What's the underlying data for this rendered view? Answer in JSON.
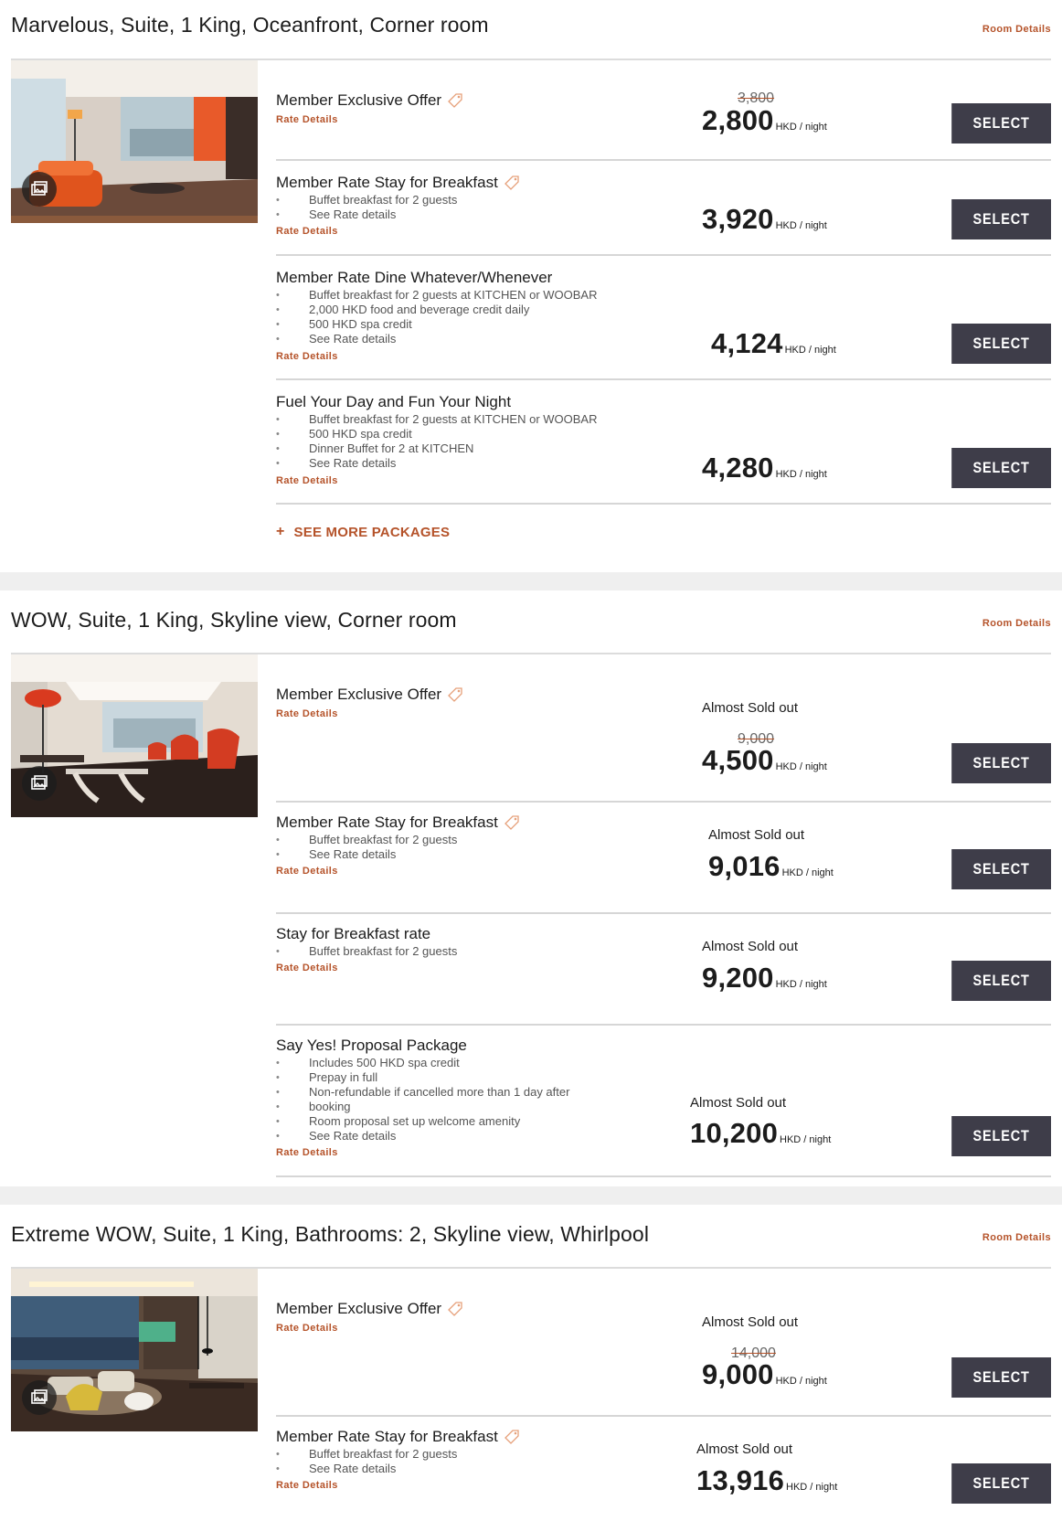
{
  "rooms": [
    {
      "title": "Marvelous, Suite, 1 King, Oceanfront, Corner room",
      "details_link": "Room Details",
      "rates": [
        {
          "name": "Member Exclusive Offer",
          "tag": true,
          "bullets": [],
          "details": "Rate Details",
          "sold_out": "",
          "old_price": "3,800",
          "price": "2,800",
          "unit": "HKD / night",
          "button": "SELECT"
        },
        {
          "name": "Member Rate Stay for Breakfast",
          "tag": true,
          "bullets": [
            "Buffet breakfast for 2 guests",
            "See Rate details"
          ],
          "details": "Rate Details",
          "sold_out": "",
          "old_price": "",
          "price": "3,920",
          "unit": "HKD / night",
          "button": "SELECT"
        },
        {
          "name": "Member Rate Dine Whatever/Whenever",
          "tag": false,
          "bullets": [
            "Buffet breakfast for 2 guests at KITCHEN or WOOBAR",
            "2,000 HKD food and beverage credit daily",
            "500 HKD spa credit",
            "See Rate details"
          ],
          "details": "Rate Details",
          "sold_out": "",
          "old_price": "",
          "price": "4,124",
          "unit": "HKD / night",
          "button": "SELECT"
        },
        {
          "name": "Fuel Your Day and Fun Your Night",
          "tag": false,
          "bullets": [
            "Buffet breakfast for 2 guests at KITCHEN or WOOBAR",
            "500 HKD spa credit",
            "Dinner Buffet for 2 at KITCHEN",
            "See Rate details"
          ],
          "details": "Rate Details",
          "sold_out": "",
          "old_price": "",
          "price": "4,280",
          "unit": "HKD / night",
          "button": "SELECT"
        }
      ],
      "see_more": "SEE MORE PACKAGES"
    },
    {
      "title": "WOW, Suite, 1 King, Skyline view, Corner room",
      "details_link": "Room Details",
      "rates": [
        {
          "name": "Member Exclusive Offer",
          "tag": true,
          "bullets": [],
          "details": "Rate Details",
          "sold_out": "Almost Sold out",
          "old_price": "9,000",
          "price": "4,500",
          "unit": "HKD / night",
          "button": "SELECT"
        },
        {
          "name": "Member Rate Stay for Breakfast",
          "tag": true,
          "bullets": [
            "Buffet breakfast for 2 guests",
            "See Rate details"
          ],
          "details": "Rate Details",
          "sold_out": "Almost Sold out",
          "old_price": "",
          "price": "9,016",
          "unit": "HKD / night",
          "button": "SELECT"
        },
        {
          "name": "Stay for Breakfast rate",
          "tag": false,
          "bullets": [
            "Buffet breakfast for 2 guests"
          ],
          "details": "Rate Details",
          "sold_out": "Almost Sold out",
          "old_price": "",
          "price": "9,200",
          "unit": "HKD / night",
          "button": "SELECT"
        },
        {
          "name": "Say Yes! Proposal Package",
          "tag": false,
          "bullets": [
            "Includes 500 HKD spa credit",
            "Prepay in full",
            "Non-refundable if cancelled more than 1 day after",
            "booking",
            "Room proposal set up welcome amenity",
            "See Rate details"
          ],
          "details": "Rate Details",
          "sold_out": "Almost Sold out",
          "old_price": "",
          "price": "10,200",
          "unit": "HKD / night",
          "button": "SELECT"
        }
      ]
    },
    {
      "title": "Extreme WOW, Suite, 1 King, Bathrooms: 2, Skyline view, Whirlpool",
      "details_link": "Room Details",
      "rates": [
        {
          "name": "Member Exclusive Offer",
          "tag": true,
          "bullets": [],
          "details": "Rate Details",
          "sold_out": "Almost Sold out",
          "old_price": "14,000",
          "price": "9,000",
          "unit": "HKD / night",
          "button": "SELECT"
        },
        {
          "name": "Member Rate Stay for Breakfast",
          "tag": true,
          "bullets": [
            "Buffet breakfast for 2 guests",
            "See Rate details"
          ],
          "details": "Rate Details",
          "sold_out": "Almost Sold out",
          "old_price": "",
          "price": "13,916",
          "unit": "HKD / night",
          "button": "SELECT"
        }
      ]
    }
  ],
  "colors": {
    "accent": "#b5532a",
    "button": "#3e3d49",
    "divider": "#d6d6d6",
    "separator": "#efefef"
  },
  "icons": {
    "tag": "tag-icon",
    "gallery": "gallery-icon",
    "plus": "plus-icon"
  }
}
